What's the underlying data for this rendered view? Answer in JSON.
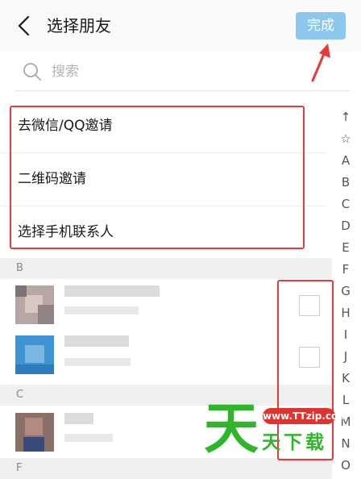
{
  "header": {
    "title": "选择朋友",
    "done_label": "完成"
  },
  "search": {
    "placeholder": "搜索"
  },
  "menu": [
    {
      "label": "去微信/QQ邀请"
    },
    {
      "label": "二维码邀请"
    },
    {
      "label": "选择手机联系人"
    }
  ],
  "sections": [
    {
      "letter": "B"
    },
    {
      "letter": "C"
    },
    {
      "letter": "F"
    }
  ],
  "index": [
    "↑",
    "☆",
    "A",
    "B",
    "C",
    "D",
    "E",
    "F",
    "G",
    "H",
    "I",
    "J",
    "K",
    "L",
    "M",
    "N",
    "O"
  ],
  "watermark": {
    "brand": "天",
    "url": "www.TTzip.com",
    "sub": "天下载"
  },
  "colors": {
    "accent": "#8cc8ee",
    "highlight": "#e53b3b",
    "watermark_green": "#2fb52a"
  }
}
